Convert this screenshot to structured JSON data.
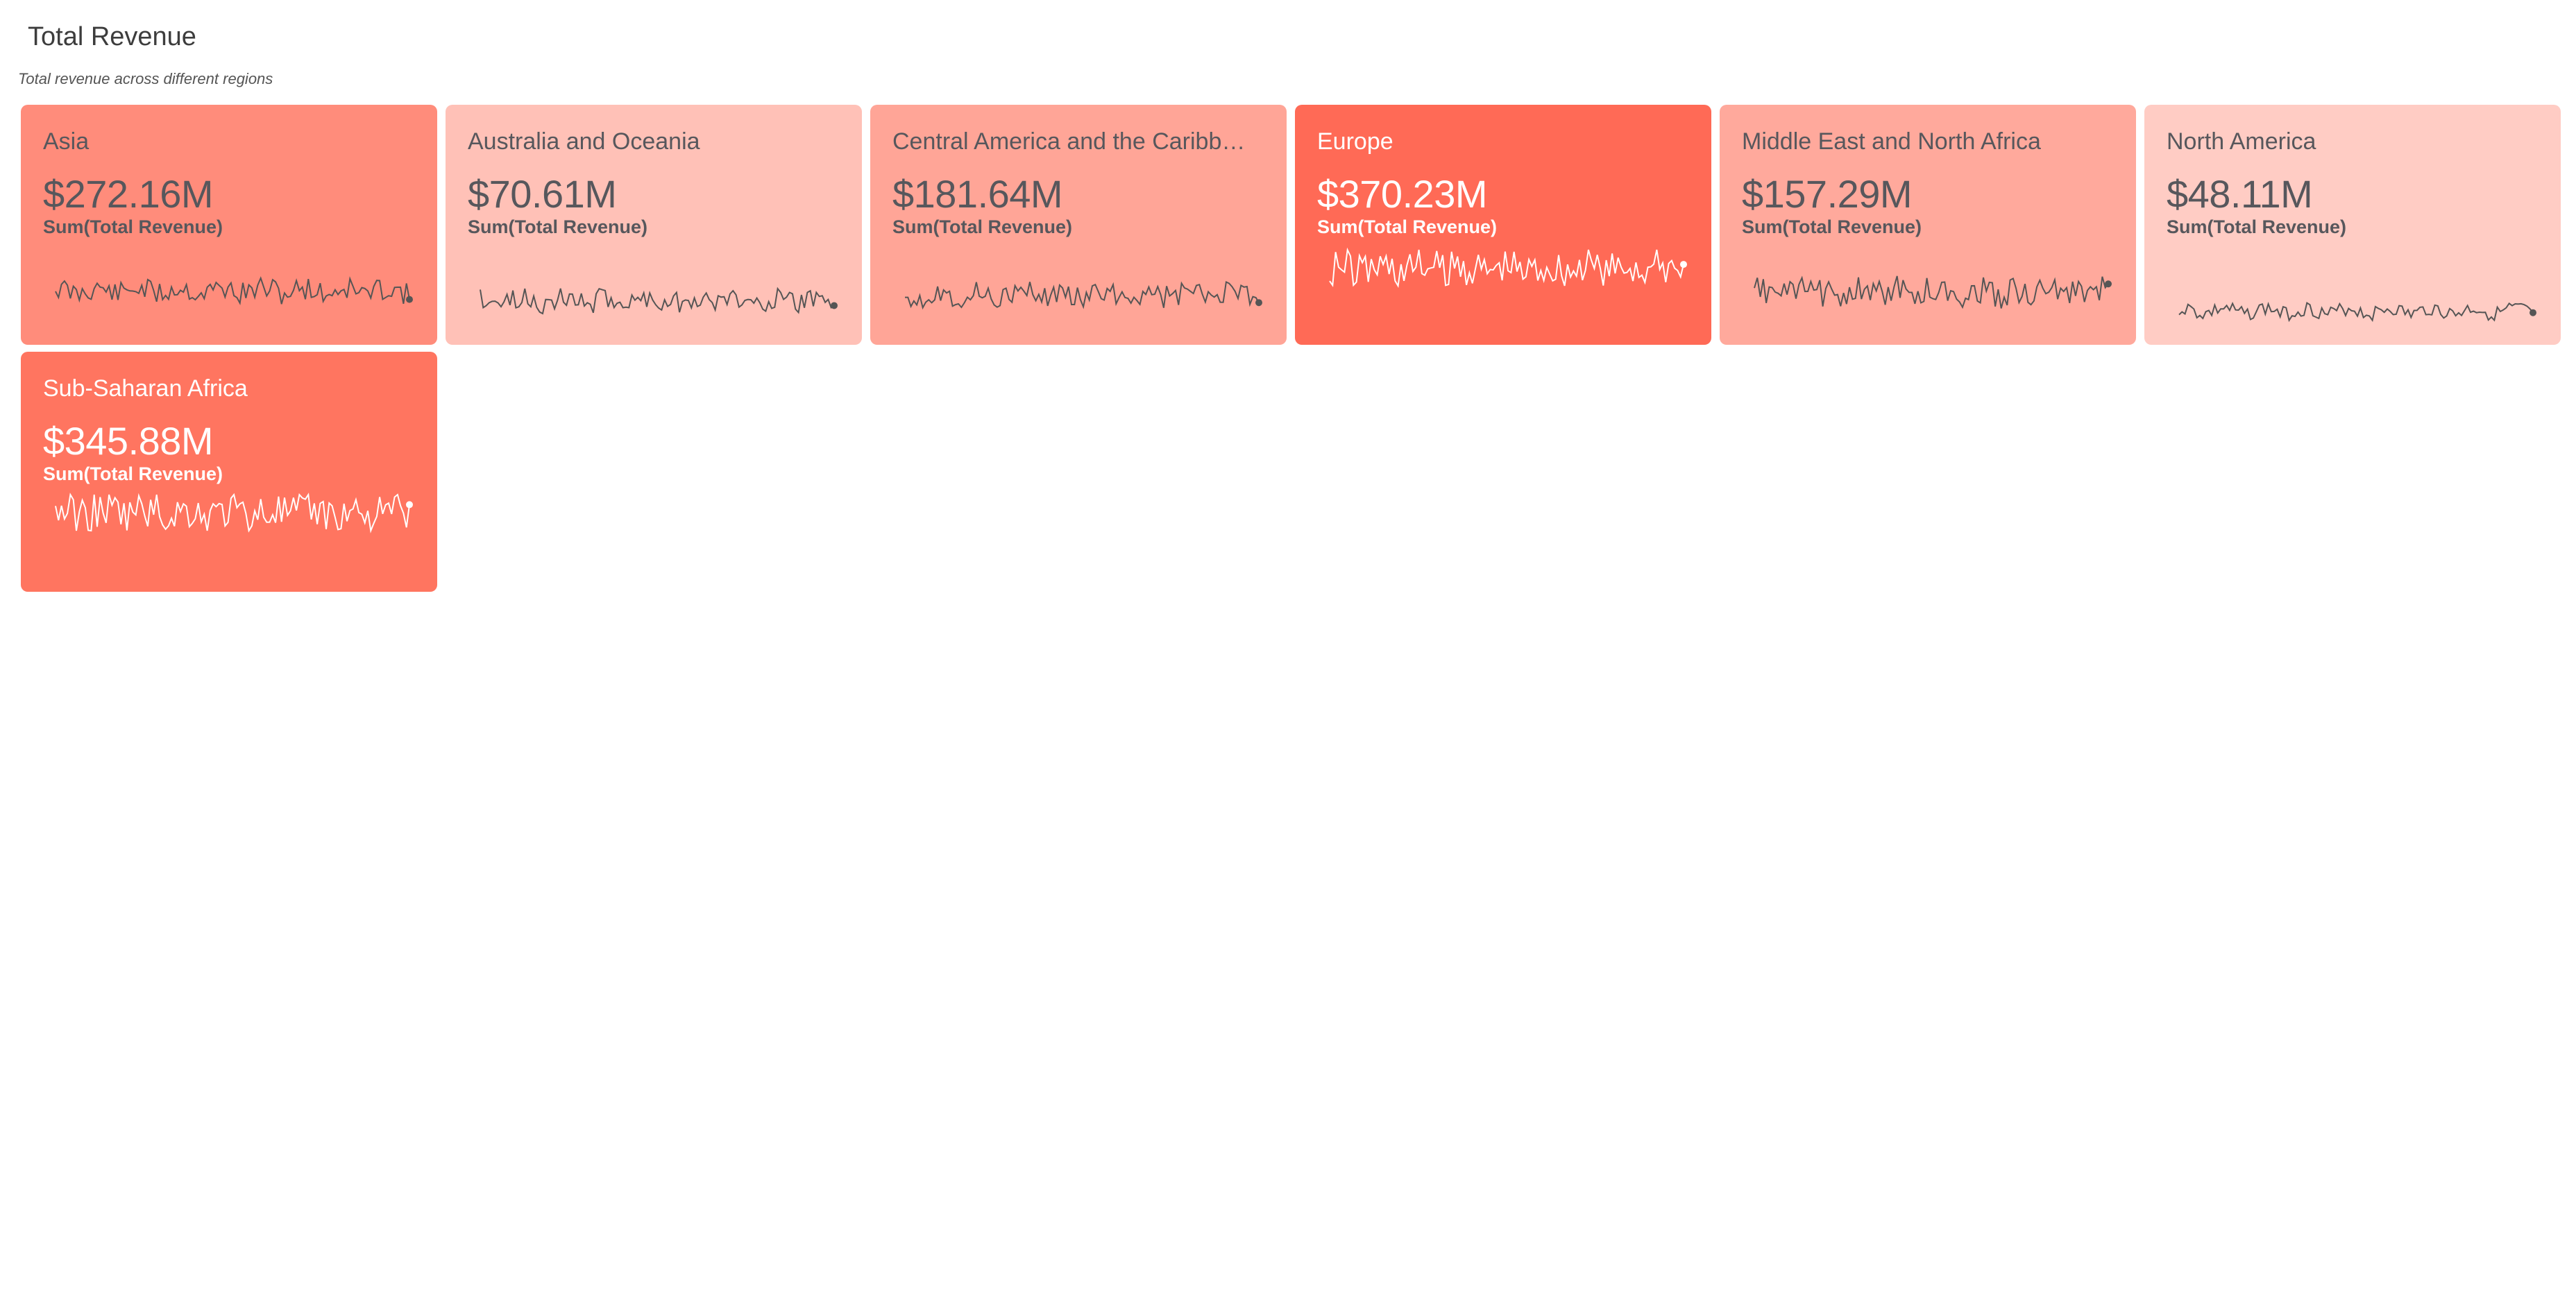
{
  "header": {
    "title": "Total Revenue",
    "subtitle": "Total revenue across different regions"
  },
  "regions": [
    {
      "name": "Asia",
      "value": "$272.16M",
      "measure": "Sum(Total Revenue)",
      "color": "#FF8C7B",
      "spark_color": "#555555",
      "amplitude": 0.55,
      "seed": 11
    },
    {
      "name": "Australia and Oceania",
      "value": "$70.61M",
      "measure": "Sum(Total Revenue)",
      "color": "#FFC1B7",
      "spark_color": "#555555",
      "amplitude": 0.55,
      "seed": 23
    },
    {
      "name": "Central America and the Caribb…",
      "value": "$181.64M",
      "measure": "Sum(Total Revenue)",
      "color": "#FFA597",
      "spark_color": "#555555",
      "amplitude": 0.55,
      "seed": 37
    },
    {
      "name": "Europe",
      "value": "$370.23M",
      "measure": "Sum(Total Revenue)",
      "color": "#FF6A56",
      "spark_color": "#ffffff",
      "amplitude": 0.95,
      "seed": 41
    },
    {
      "name": "Middle East and North Africa",
      "value": "$157.29M",
      "measure": "Sum(Total Revenue)",
      "color": "#FFA99C",
      "spark_color": "#555555",
      "amplitude": 0.7,
      "seed": 53
    },
    {
      "name": "North America",
      "value": "$48.11M",
      "measure": "Sum(Total Revenue)",
      "color": "#FFCCC4",
      "spark_color": "#555555",
      "amplitude": 0.35,
      "seed": 67
    },
    {
      "name": "Sub-Saharan Africa",
      "value": "$345.88M",
      "measure": "Sum(Total Revenue)",
      "color": "#FF7560",
      "spark_color": "#ffffff",
      "amplitude": 0.95,
      "seed": 79
    }
  ]
}
